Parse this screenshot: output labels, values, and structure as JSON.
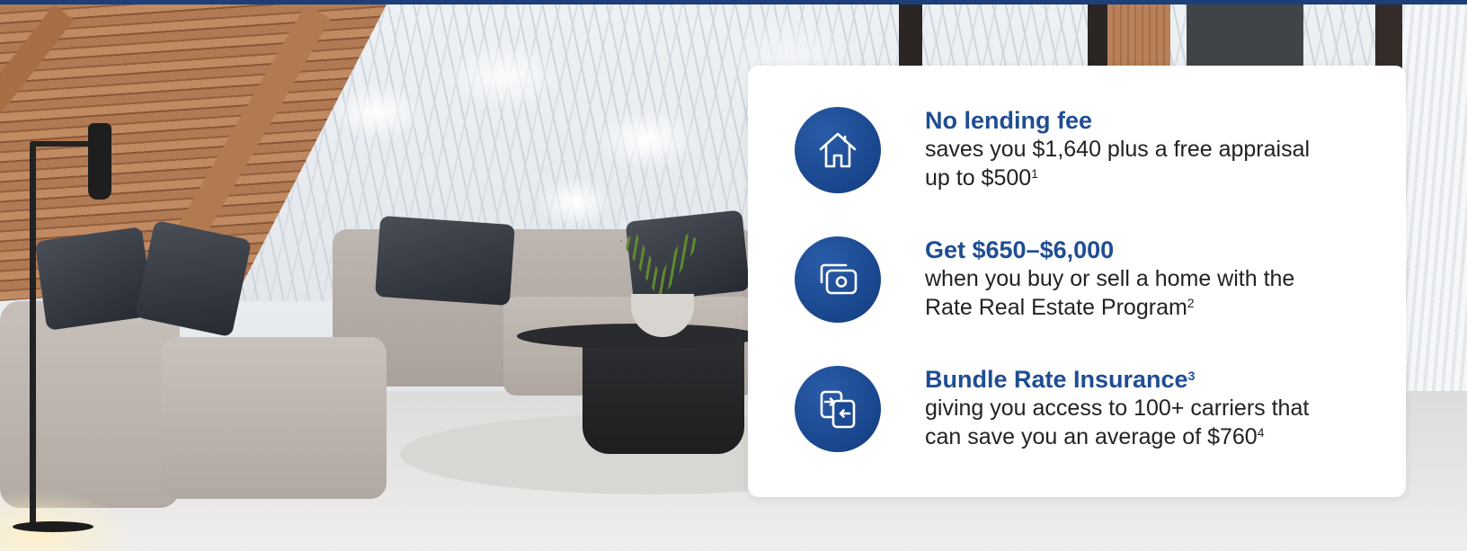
{
  "colors": {
    "brand_blue": "#1f4d94",
    "icon_circle": "#1c4a92",
    "top_bar": "#1c3f7a",
    "card_bg": "#ffffff",
    "body_text": "#222222"
  },
  "features": [
    {
      "icon": "house-icon",
      "title": "No lending fee",
      "title_sup": "",
      "desc_line1": "saves you $1,640 plus a free appraisal",
      "desc_line2": "up to $500",
      "desc_sup": "1"
    },
    {
      "icon": "camera-card-icon",
      "title": "Get $650–$6,000",
      "title_sup": "",
      "desc_line1": "when you buy or sell a home with the",
      "desc_line2": "Rate Real Estate Program",
      "desc_sup": "2"
    },
    {
      "icon": "swap-documents-icon",
      "title": "Bundle Rate Insurance",
      "title_sup": "3",
      "desc_line1": "giving you access to 100+ carriers that",
      "desc_line2": "can save you an average of $760",
      "desc_sup": "4"
    }
  ]
}
